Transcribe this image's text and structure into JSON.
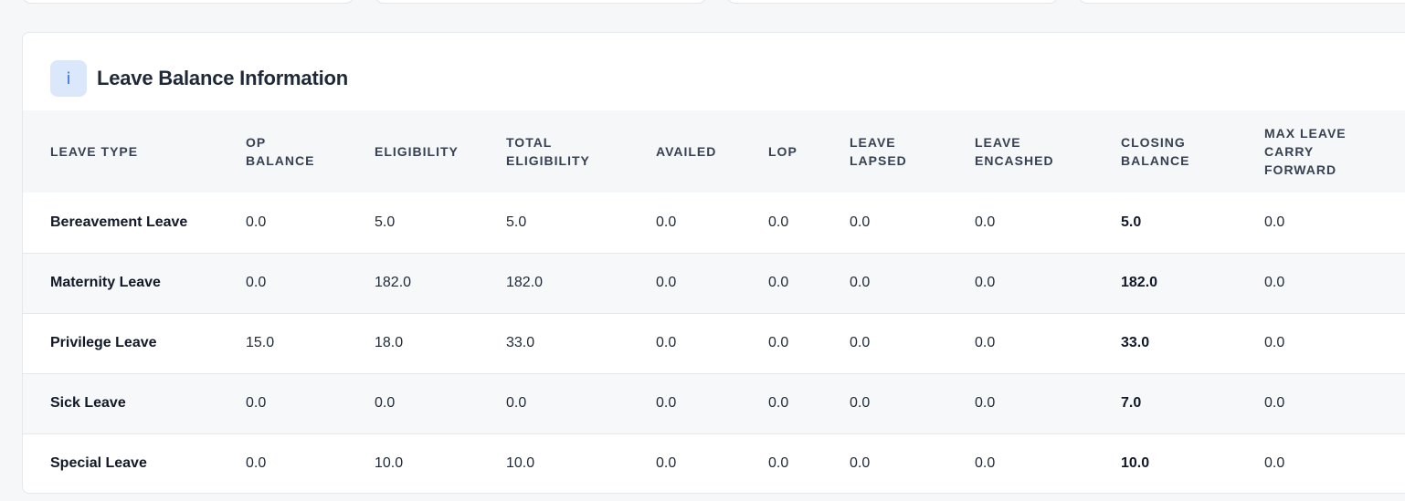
{
  "panel": {
    "icon": "info-icon",
    "icon_glyph": "i",
    "title": "Leave Balance Information"
  },
  "table": {
    "headers": [
      [
        "LEAVE TYPE"
      ],
      [
        "OP",
        "BALANCE"
      ],
      [
        "ELIGIBILITY"
      ],
      [
        "TOTAL",
        "ELIGIBILITY"
      ],
      [
        "AVAILED"
      ],
      [
        "LOP"
      ],
      [
        "LEAVE",
        "LAPSED"
      ],
      [
        "LEAVE",
        "ENCASHED"
      ],
      [
        "CLOSING",
        "BALANCE"
      ],
      [
        "MAX LEAVE",
        "CARRY",
        "FORWARD"
      ]
    ],
    "rows": [
      [
        "Bereavement Leave",
        "0.0",
        "5.0",
        "5.0",
        "0.0",
        "0.0",
        "0.0",
        "0.0",
        "5.0",
        "0.0"
      ],
      [
        "Maternity Leave",
        "0.0",
        "182.0",
        "182.0",
        "0.0",
        "0.0",
        "0.0",
        "0.0",
        "182.0",
        "0.0"
      ],
      [
        "Privilege Leave",
        "15.0",
        "18.0",
        "33.0",
        "0.0",
        "0.0",
        "0.0",
        "0.0",
        "33.0",
        "0.0"
      ],
      [
        "Sick Leave",
        "0.0",
        "0.0",
        "0.0",
        "0.0",
        "0.0",
        "0.0",
        "0.0",
        "7.0",
        "0.0"
      ],
      [
        "Special Leave",
        "0.0",
        "10.0",
        "10.0",
        "0.0",
        "0.0",
        "0.0",
        "0.0",
        "10.0",
        "0.0"
      ]
    ]
  },
  "colors": {
    "accent": "#2f6fdc",
    "badge_bg": "#dbe7fb",
    "header_bg": "#f6f7f9"
  }
}
